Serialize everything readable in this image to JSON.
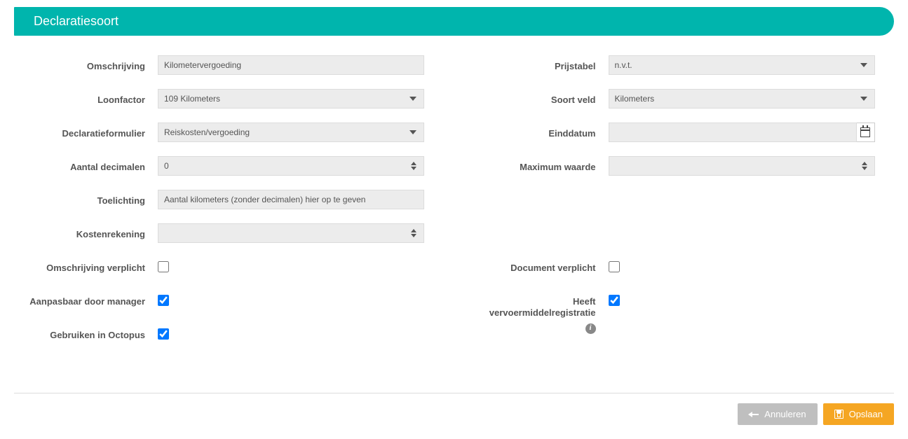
{
  "header": {
    "title": "Declaratiesoort"
  },
  "left": {
    "omschrijving": {
      "label": "Omschrijving",
      "value": "Kilometervergoeding"
    },
    "loonfactor": {
      "label": "Loonfactor",
      "value": "109 Kilometers"
    },
    "declaratieformulier": {
      "label": "Declaratieformulier",
      "value": "Reiskosten/vergoeding"
    },
    "aantal_decimalen": {
      "label": "Aantal decimalen",
      "value": "0"
    },
    "toelichting": {
      "label": "Toelichting",
      "value": "Aantal kilometers (zonder decimalen) hier op te geven"
    },
    "kostenrekening": {
      "label": "Kostenrekening",
      "value": ""
    },
    "omschrijving_verplicht": {
      "label": "Omschrijving verplicht",
      "checked": false
    },
    "aanpasbaar": {
      "label": "Aanpasbaar door manager",
      "checked": true
    },
    "octopus": {
      "label": "Gebruiken in Octopus",
      "checked": true
    }
  },
  "right": {
    "prijstabel": {
      "label": "Prijstabel",
      "value": "n.v.t."
    },
    "soort_veld": {
      "label": "Soort veld",
      "value": "Kilometers"
    },
    "einddatum": {
      "label": "Einddatum",
      "value": ""
    },
    "maximum_waarde": {
      "label": "Maximum waarde",
      "value": ""
    },
    "document_verplicht": {
      "label": "Document verplicht",
      "checked": false
    },
    "vervoermiddel": {
      "label": "Heeft vervoermiddelregistratie",
      "checked": true
    }
  },
  "actions": {
    "cancel": "Annuleren",
    "save": "Opslaan"
  }
}
